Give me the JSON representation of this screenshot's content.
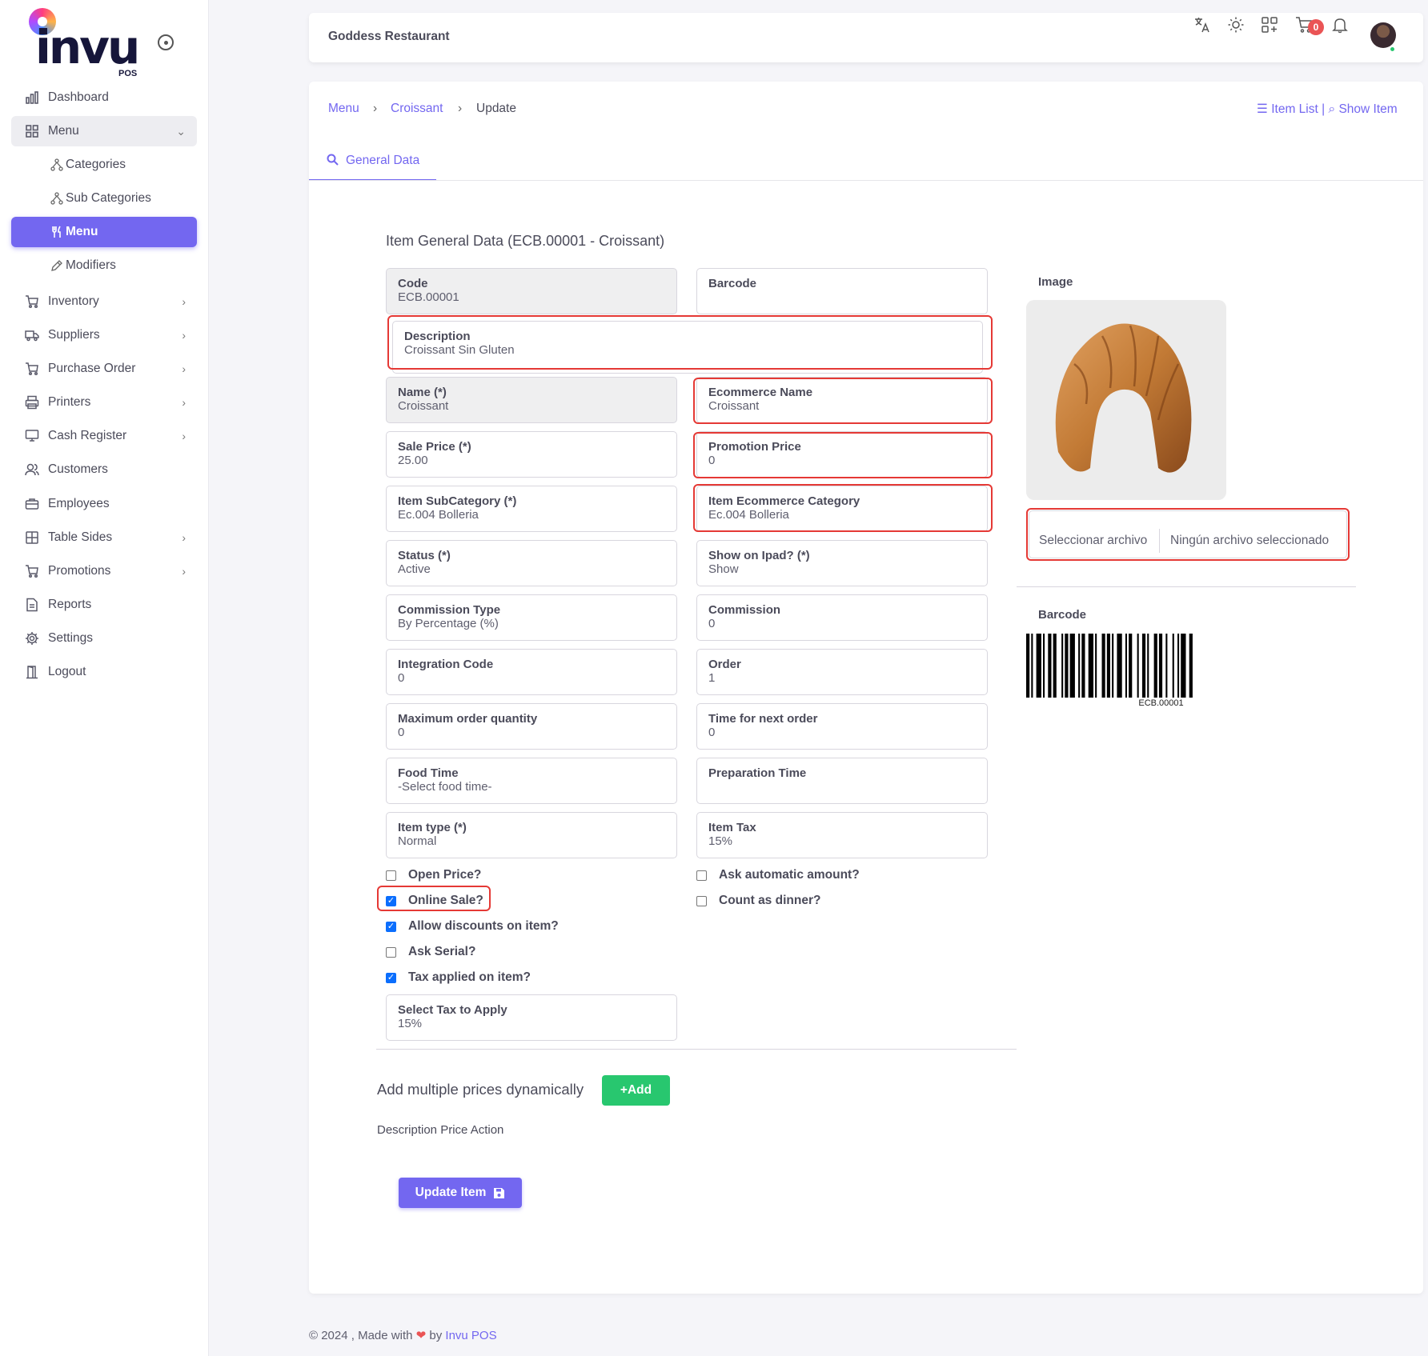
{
  "brand": {
    "logo_text": "invu",
    "logo_sub": "POS"
  },
  "sidebar": {
    "items": [
      {
        "label": "Dashboard",
        "icon": "bar-chart-icon"
      },
      {
        "label": "Menu",
        "icon": "grid-icon"
      },
      {
        "label": "Inventory",
        "icon": "cart-inventory-icon"
      },
      {
        "label": "Suppliers",
        "icon": "truck-icon"
      },
      {
        "label": "Purchase Order",
        "icon": "cart-icon"
      },
      {
        "label": "Printers",
        "icon": "printer-icon"
      },
      {
        "label": "Cash Register",
        "icon": "cash-register-icon"
      },
      {
        "label": "Customers",
        "icon": "users-icon"
      },
      {
        "label": "Employees",
        "icon": "briefcase-icon"
      },
      {
        "label": "Table Sides",
        "icon": "table-icon"
      },
      {
        "label": "Promotions",
        "icon": "cart-promo-icon"
      },
      {
        "label": "Reports",
        "icon": "file-icon"
      },
      {
        "label": "Settings",
        "icon": "gear-icon"
      },
      {
        "label": "Logout",
        "icon": "door-icon"
      }
    ],
    "submenu": [
      {
        "label": "Categories"
      },
      {
        "label": "Sub Categories"
      },
      {
        "label": "Menu"
      },
      {
        "label": "Modifiers"
      }
    ]
  },
  "header": {
    "restaurant": "Goddess Restaurant",
    "cart_count": "0"
  },
  "breadcrumb": {
    "menu": "Menu",
    "item": "Croissant",
    "current": "Update"
  },
  "links": {
    "item_list": "Item List",
    "sep": "|",
    "show_item": "Show Item"
  },
  "tab": {
    "label": "General Data"
  },
  "form": {
    "title": "Item General Data (ECB.00001 - Croissant)",
    "code": {
      "label": "Code",
      "value": "ECB.00001"
    },
    "barcode": {
      "label": "Barcode",
      "value": ""
    },
    "description": {
      "label": "Description",
      "value": "Croissant Sin Gluten"
    },
    "name": {
      "label": "Name (*)",
      "value": "Croissant"
    },
    "ecommerce_name": {
      "label": "Ecommerce Name",
      "value": "Croissant"
    },
    "sale_price": {
      "label": "Sale Price (*)",
      "value": "25.00"
    },
    "promotion_price": {
      "label": "Promotion Price",
      "value": "0"
    },
    "item_subcategory": {
      "label": "Item SubCategory (*)",
      "value": "Ec.004 Bolleria"
    },
    "item_ecommerce_category": {
      "label": "Item Ecommerce Category",
      "value": "Ec.004 Bolleria"
    },
    "status": {
      "label": "Status (*)",
      "value": "Active"
    },
    "show_on_ipad": {
      "label": "Show on Ipad? (*)",
      "value": "Show"
    },
    "commission_type": {
      "label": "Commission Type",
      "value": "By Percentage (%)"
    },
    "commission": {
      "label": "Commission",
      "value": "0"
    },
    "integration_code": {
      "label": "Integration Code",
      "value": "0"
    },
    "order": {
      "label": "Order",
      "value": "1"
    },
    "max_order_qty": {
      "label": "Maximum order quantity",
      "value": "0"
    },
    "time_next_order": {
      "label": "Time for next order",
      "value": "0"
    },
    "food_time": {
      "label": "Food Time",
      "value": "-Select food time-"
    },
    "prep_time": {
      "label": "Preparation Time",
      "value": ""
    },
    "item_type": {
      "label": "Item type (*)",
      "value": "Normal"
    },
    "item_tax": {
      "label": "Item Tax",
      "value": "15%"
    },
    "select_tax": {
      "label": "Select Tax to Apply",
      "value": "15%"
    }
  },
  "checkboxes": {
    "open_price": {
      "label": "Open Price?",
      "checked": false
    },
    "online_sale": {
      "label": "Online Sale?",
      "checked": true
    },
    "allow_discounts": {
      "label": "Allow discounts on item?",
      "checked": true
    },
    "ask_serial": {
      "label": "Ask Serial?",
      "checked": false
    },
    "tax_applied": {
      "label": "Tax applied on item?",
      "checked": true
    },
    "ask_auto_amount": {
      "label": "Ask automatic amount?",
      "checked": false
    },
    "count_dinner": {
      "label": "Count as dinner?",
      "checked": false
    }
  },
  "image_panel": {
    "image_label": "Image",
    "file_button": "Seleccionar archivo",
    "file_name": "Ningún archivo seleccionado",
    "barcode_label": "Barcode",
    "barcode_text": "ECB.00001"
  },
  "multi_prices": {
    "title": "Add multiple prices dynamically",
    "add_label": "+Add",
    "headers": "Description Price Action"
  },
  "update_button": "Update Item",
  "footer": {
    "text": "© 2024 , Made with",
    "by": "by",
    "brand": "Invu POS"
  },
  "colors": {
    "accent": "#7367f0",
    "success": "#28c76f",
    "danger": "#ea5455",
    "highlight": "#e53935"
  }
}
